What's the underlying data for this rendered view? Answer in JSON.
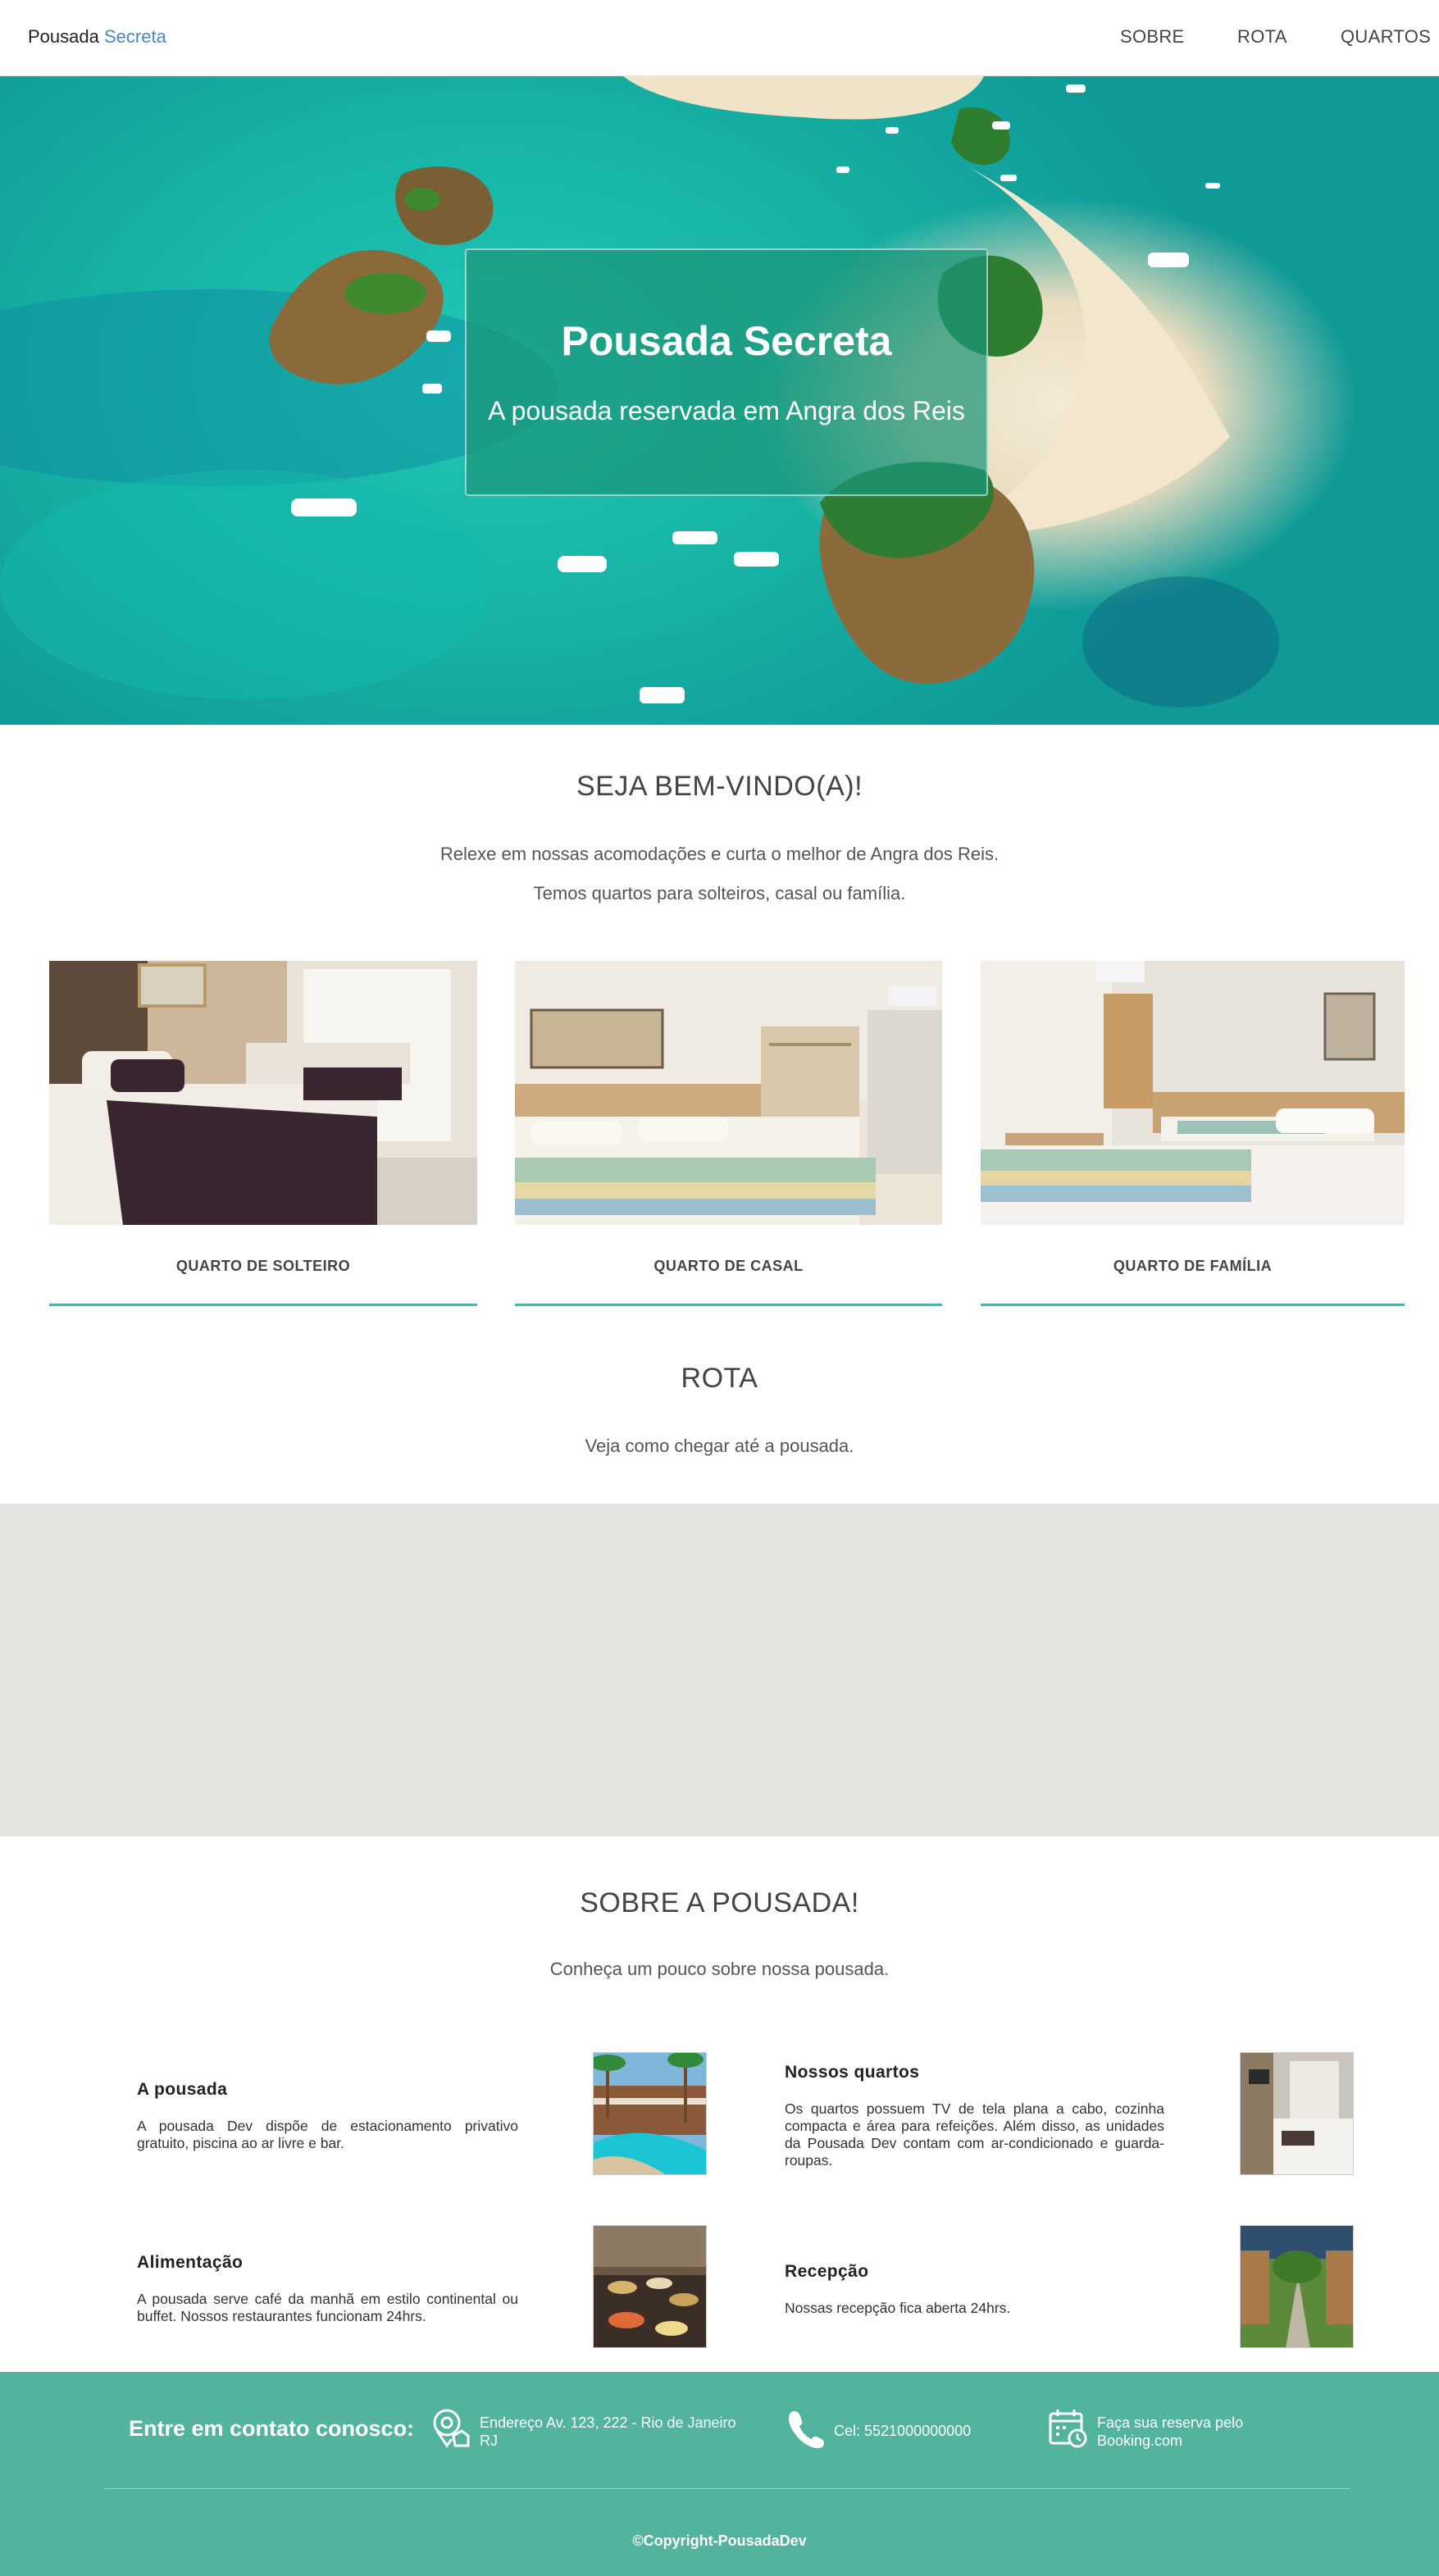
{
  "nav": {
    "brand_main": "Pousada",
    "brand_accent": "Secreta",
    "links": [
      "SOBRE",
      "ROTA",
      "QUARTOS"
    ]
  },
  "hero": {
    "title": "Pousada Secreta",
    "subtitle": "A pousada reservada em Angra dos Reis"
  },
  "welcome": {
    "title": "SEJA BEM-VINDO(A)!",
    "line1": "Relexe em nossas acomodações e curta o melhor de Angra dos Reis.",
    "line2": "Temos quartos para solteiros, casal ou família."
  },
  "rooms": [
    {
      "label": "QUARTO DE SOLTEIRO"
    },
    {
      "label": "QUARTO DE CASAL"
    },
    {
      "label": "QUARTO DE FAMÍLIA"
    }
  ],
  "route": {
    "title": "ROTA",
    "subtitle": "Veja como chegar até a pousada."
  },
  "about": {
    "title": "SOBRE A POUSADA!",
    "subtitle": "Conheça um pouco sobre nossa pousada.",
    "items": [
      {
        "title": "A pousada",
        "text": "A pousada Dev dispõe de estacionamento privativo gratuito, piscina ao ar livre e bar."
      },
      {
        "title": "Nossos quartos",
        "text": "Os quartos possuem TV de tela plana a cabo, cozinha compacta e área para refeições. Além disso, as unidades da Pousada Dev contam com ar-condicionado e guarda-roupas."
      },
      {
        "title": "Alimentação",
        "text": "A pousada serve café da manhã em estilo continental ou buffet. Nossos restaurantes funcionam 24hrs."
      },
      {
        "title": "Recepção",
        "text": "Nossas recepção fica aberta 24hrs."
      }
    ]
  },
  "footer": {
    "contact_title": "Entre em contato conosco:",
    "address": "Endereço Av. 123, 222 - Rio de Janeiro RJ",
    "phone": "Cel: 5521000000000",
    "booking": "Faça sua reserva pelo Booking.com",
    "copyright": "©Copyright-PousadaDev"
  },
  "colors": {
    "accent_teal": "#52b39e",
    "brand_blue": "#4a86c8",
    "map_bg": "#e5e3df"
  },
  "icons": [
    "location-pin-icon",
    "phone-icon",
    "calendar-clock-icon"
  ]
}
